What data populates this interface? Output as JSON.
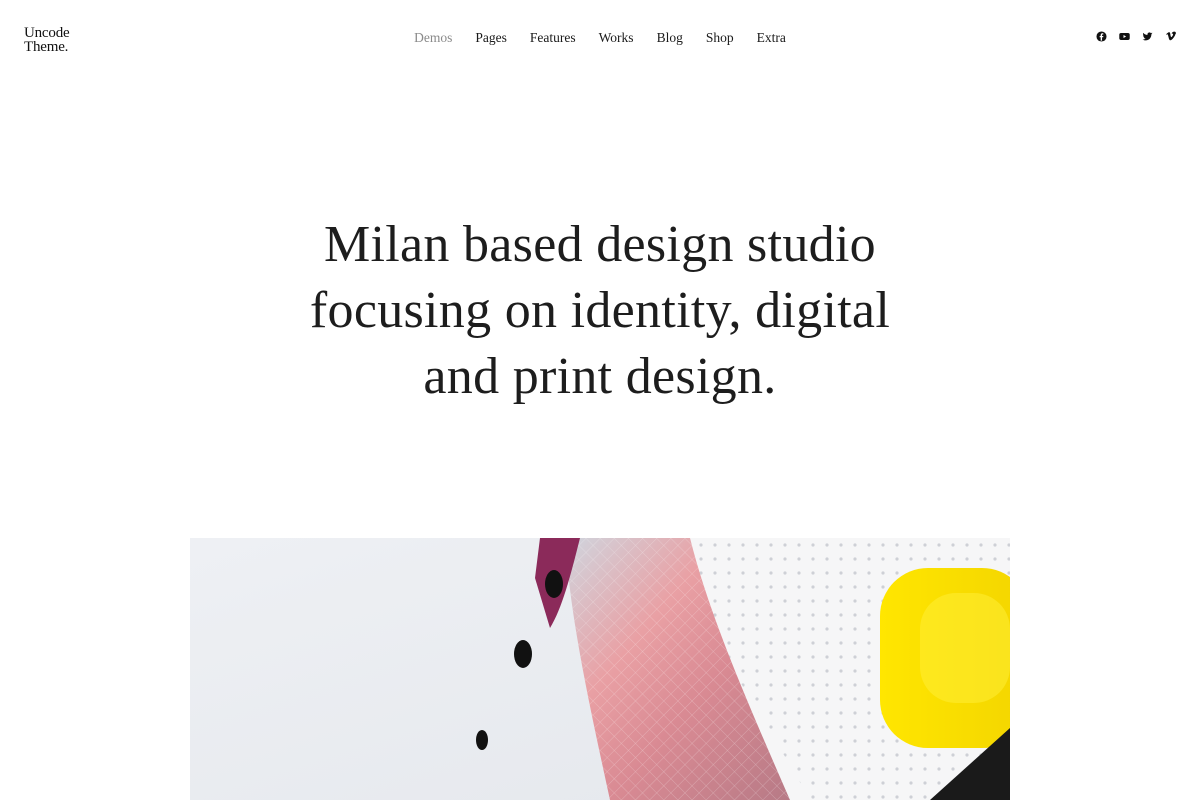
{
  "brand": {
    "line1": "Uncode",
    "line2": "Theme."
  },
  "nav": {
    "items": [
      "Demos",
      "Pages",
      "Features",
      "Works",
      "Blog",
      "Shop",
      "Extra"
    ],
    "active_index": 0
  },
  "social": {
    "icons": [
      "facebook-icon",
      "youtube-icon",
      "twitter-icon",
      "vimeo-icon"
    ]
  },
  "hero": {
    "lines": [
      "Milan based design studio",
      "focusing on identity, digital",
      "and print design."
    ]
  },
  "colors": {
    "text": "#1a1a1a",
    "nav_active": "#8a8a8a",
    "background": "#ffffff",
    "accent_yellow": "#f7e61a",
    "accent_pink": "#e98a93"
  }
}
